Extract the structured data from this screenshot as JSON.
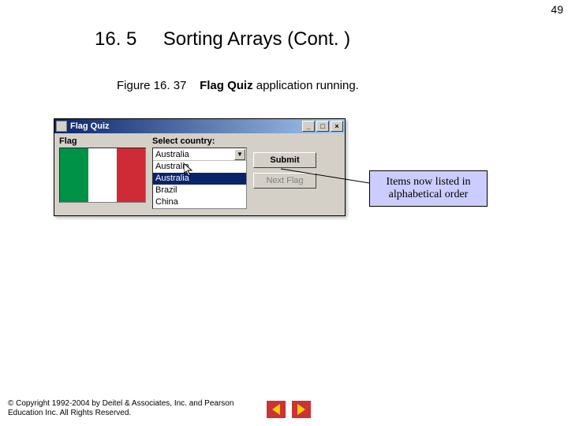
{
  "page_number": "49",
  "heading": {
    "section": "16. 5",
    "title": "Sorting Arrays (Cont. )"
  },
  "caption": {
    "figure": "Figure 16. 37",
    "bold": "Flag Quiz",
    "rest": " application running."
  },
  "app": {
    "title": "Flag Quiz",
    "flag_label": "Flag",
    "select_label": "Select country:",
    "selected": "Australia",
    "options": [
      "Australia",
      "Australia",
      "Brazil",
      "China"
    ],
    "selected_index": 1,
    "submit": "Submit",
    "next": "Next Flag",
    "flag_colors": [
      "green",
      "white",
      "red"
    ]
  },
  "callout": "Items now listed in alphabetical order",
  "copyright": "© Copyright 1992-2004 by Deitel & Associates, Inc. and Pearson Education Inc. All Rights Reserved."
}
